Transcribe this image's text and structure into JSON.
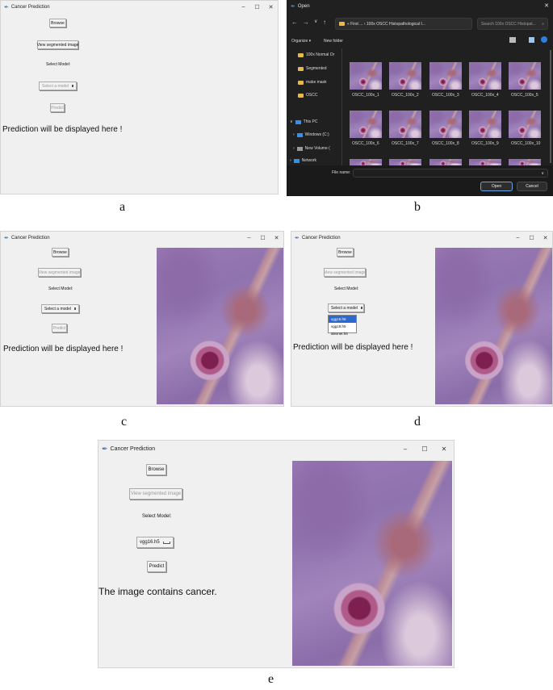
{
  "app": {
    "title": "Cancer Prediction",
    "minimize": "–",
    "maximize": "☐",
    "close": "✕"
  },
  "buttons": {
    "browse": "Browse",
    "view_segmented": "View segmented image",
    "predict": "Predict"
  },
  "labels": {
    "select_model": "Select Model:"
  },
  "option_default": "Select a model",
  "option_selected": "vgg16.h5",
  "models": [
    "vgg16.h5",
    "vgg19.h5",
    "alexnet.h5"
  ],
  "result_placeholder": "Prediction will be displayed here !",
  "result_final": "The image contains cancer.",
  "captions": {
    "a": "a",
    "b": "b",
    "c": "c",
    "d": "d",
    "e": "e"
  },
  "dialog": {
    "title": "Open",
    "breadcrumb": "« First ... › 100x OSCC Histopathological I...",
    "search_placeholder": "Search 100x OSCC Histopat...",
    "organize": "Organize ▾",
    "new_folder": "New folder",
    "sidebar": [
      "100x Normal Or",
      "Segmented",
      "make mask",
      "OSCC",
      "This PC",
      "Windows (C:)",
      "New Volume (",
      "Network"
    ],
    "thumbs_row1": [
      "OSCC_100x_1",
      "OSCC_100x_2",
      "OSCC_100x_3",
      "OSCC_100x_4",
      "OSCC_100x_5"
    ],
    "thumbs_row2": [
      "OSCC_100x_6",
      "OSCC_100x_7",
      "OSCC_100x_8",
      "OSCC_100x_9",
      "OSCC_100x_10"
    ],
    "file_name_label": "File name:",
    "open": "Open",
    "cancel": "Cancel"
  }
}
